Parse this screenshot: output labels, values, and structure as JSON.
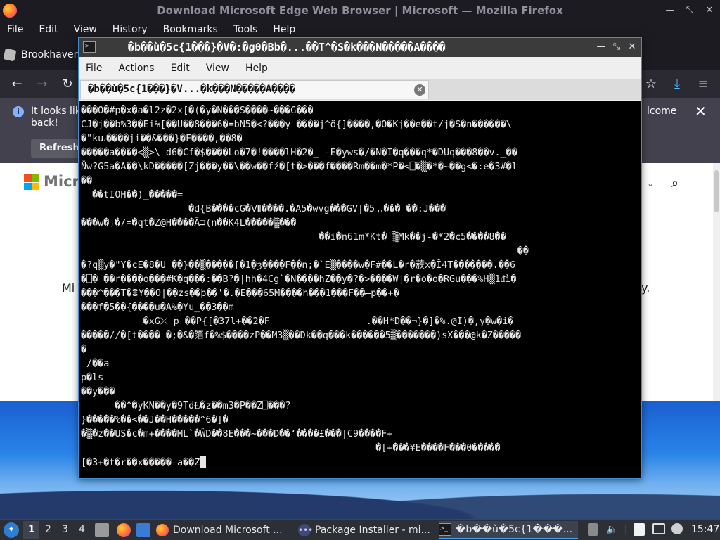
{
  "firefox": {
    "window_title": "Download Microsoft Edge Web Browser | Microsoft — Mozilla Firefox",
    "menu": [
      "File",
      "Edit",
      "View",
      "History",
      "Bookmarks",
      "Tools",
      "Help"
    ],
    "tab_label": "Brookhaven",
    "infobar": {
      "text": "It looks lik back!",
      "text_line1": "It looks lik",
      "text_line2": "back!",
      "button": "Refresh",
      "right_text": "lcome"
    },
    "page": {
      "brand": "Micro",
      "text_left": "Mi",
      "text_right": "y."
    }
  },
  "terminal": {
    "window_title": "�b��ù�5c{1���}�V�:�g0�Bb�...��T^�S�k���N�����A����",
    "menu": [
      "File",
      "Actions",
      "Edit",
      "View",
      "Help"
    ],
    "tab_label": "�b��ù�5c{1���}�V...�k���N�����A����",
    "lines": [
      "���O�#p�x�a�l2z�2x[�(�y�N���S����~���G���",
      "CJ�j��b%3��Ei%[��U��8���6�=bN5�<?���y ����j^õ{]����,�O�Kj��e��t/j�S�n������\\",
      "�\"ku៸����ji��&���}�F����,��8�",
      "�����a����<▒>\\ d6�Cf�$����Lo�7�!����lH�2�_ -E�yws�/�N�I�q���q*�DUq���8��v._��",
      "Ňw?G5a�A��\\kD�����[Zj���y��\\��w��fź�[t�>���f����Rm��m�*P�<⎕�▒�*�~��g<�:e�3#�l",
      "��",
      "  ��tIOH��)_�����=",
      "                   �d{B����cG�Ⅶ����.�A5�wvg���GV|�5ᆩ��� ��:J���",
      "���w�ⱼ�/=�qt�Z@H����Ȃ⊐(n��K4L�����▒���",
      "                                          ��i�n61m*Kt�˙▒Mk��j-�*2�c5����8��",
      "                                                                             ��",
      "�?q▒y�\"Y�cE�8�U ��}��▒�����[�1�ȝ����F��n;�`E▒����w�F#��L�r�蔟x�Ĭ4T�������.��6",
      "�⎕� ��r����o���#K�q���:��B?�|hh�4Cg`�N����hZ��y�?�>����W|�r�o�o�RGu���%H▒1ᵭì�",
      "���^���T�ⴻY��O|��zs��ϸ��'�.�E���65M����h���1���F��⟵p��+�",
      "���f�5��{����u�A%�Yu_��3��m",
      "           �xG⤫ p ��P{[�37l+��2�F                 .��H*D��¬}�]�%.@I)�,y�w�i�",
      "�����//�[t���� �;�&�箔f�%$����zP��M3▒��Dk��q���k������5▒�������)sX���@k�Z�����",
      "�",
      " /��a",
      "p�ls",
      "��y���",
      "      ��^�yKN��y�9TdⱢ�z��m3�P��Z⎕���?",
      "}�����%��<��J��H�����^6�]�",
      "�▒�z��US�c�m+����ML`�ŴD��8E���~���D��‘����£���|C9����F+",
      "                                                    �[+���¥E����F���0�����",
      "[�3+�t�r��x�����-a��Z"
    ]
  },
  "taskbar": {
    "workspaces": [
      "1",
      "2",
      "3",
      "4"
    ],
    "tasks": [
      {
        "label": "Download Microsoft ..."
      },
      {
        "label": "Package Installer - mi..."
      },
      {
        "label": "�b��ù�5c{1���..."
      }
    ],
    "clock": "15:47"
  }
}
